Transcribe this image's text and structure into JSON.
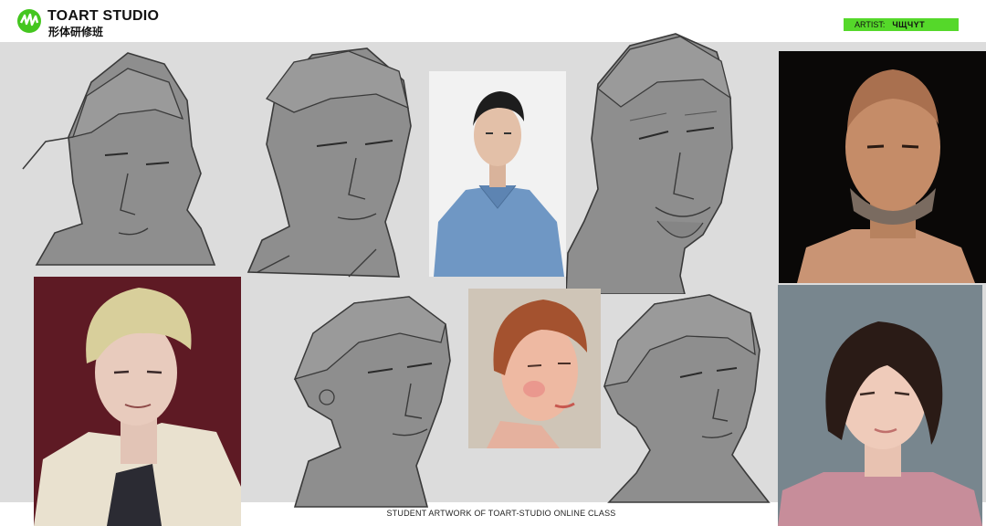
{
  "header": {
    "brand_title": "TOART STUDIO",
    "brand_subtitle": "形体研修班",
    "artist_label": "ARTIST:",
    "artist_name": "ЧЩЧYT"
  },
  "footer": {
    "caption": "STUDENT ARTWORK OF TOART-STUDIO ONLINE CLASS"
  },
  "colors": {
    "accent": "#55d82a",
    "canvas": "#dcdcdc",
    "sketch_fill": "#8e8e8e",
    "sketch_line": "#3a3a3a"
  },
  "icons": [
    "toart-logo-icon"
  ]
}
